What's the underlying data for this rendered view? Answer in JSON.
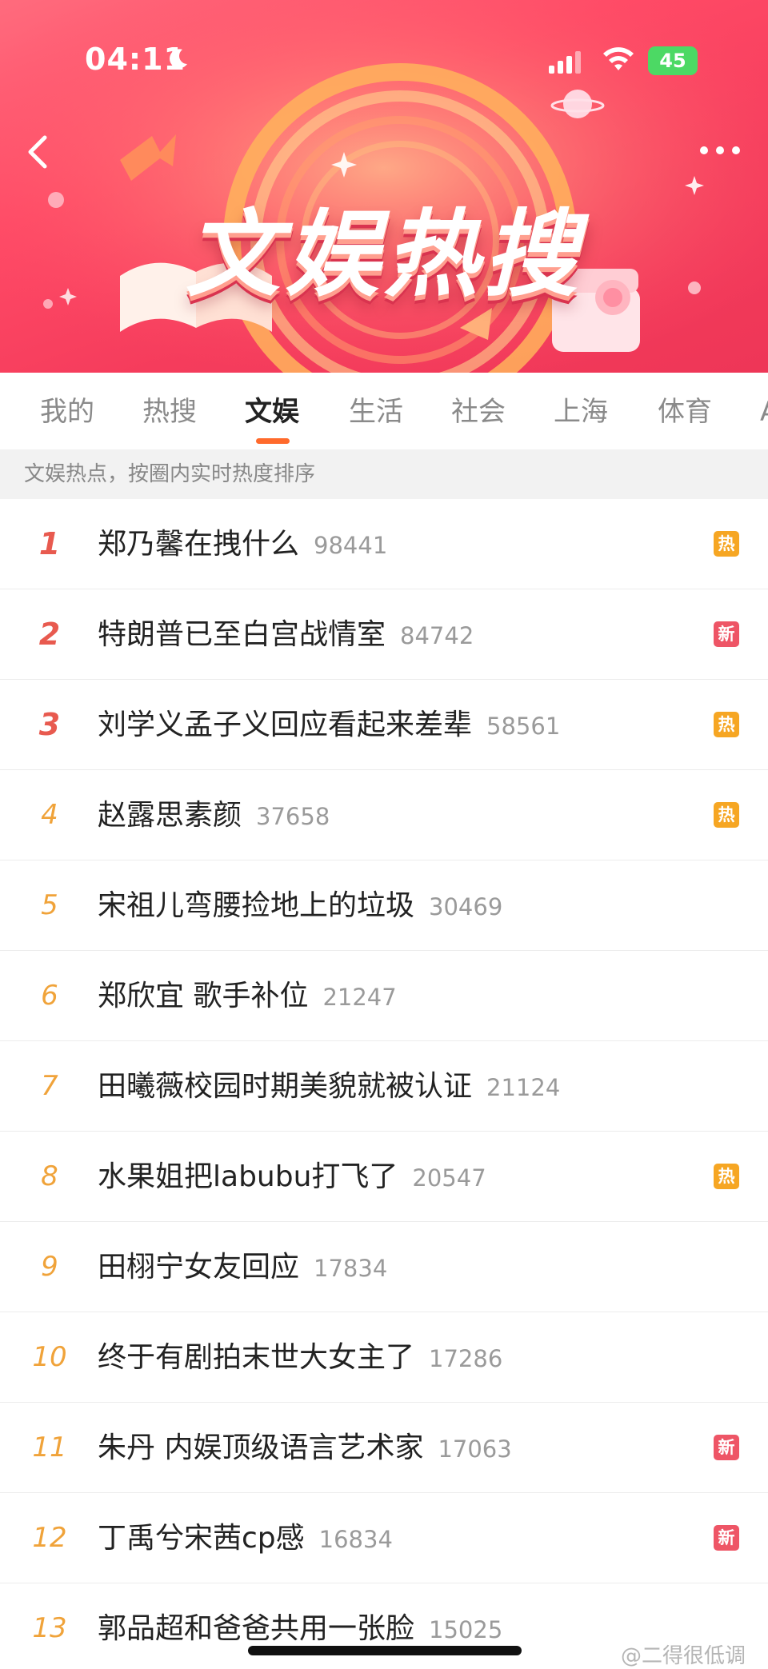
{
  "status_bar": {
    "time": "04:11",
    "battery": "45"
  },
  "header": {
    "title": "文娱热搜"
  },
  "tabs": [
    {
      "label": "我的"
    },
    {
      "label": "热搜"
    },
    {
      "label": "文娱",
      "active": true
    },
    {
      "label": "生活"
    },
    {
      "label": "社会"
    },
    {
      "label": "上海"
    },
    {
      "label": "体育"
    },
    {
      "label": "A"
    }
  ],
  "subtitle": "文娱热点，按圈内实时热度排序",
  "rows": [
    {
      "rank": "1",
      "title": "郑乃馨在拽什么",
      "count": "98441",
      "badge": "热"
    },
    {
      "rank": "2",
      "title": "特朗普已至白宫战情室",
      "count": "84742",
      "badge": "新"
    },
    {
      "rank": "3",
      "title": "刘学义孟子义回应看起来差辈",
      "count": "58561",
      "badge": "热"
    },
    {
      "rank": "4",
      "title": "赵露思素颜",
      "count": "37658",
      "badge": "热"
    },
    {
      "rank": "5",
      "title": "宋祖儿弯腰捡地上的垃圾",
      "count": "30469",
      "badge": ""
    },
    {
      "rank": "6",
      "title": "郑欣宜 歌手补位",
      "count": "21247",
      "badge": ""
    },
    {
      "rank": "7",
      "title": "田曦薇校园时期美貌就被认证",
      "count": "21124",
      "badge": ""
    },
    {
      "rank": "8",
      "title": "水果姐把labubu打飞了",
      "count": "20547",
      "badge": "热"
    },
    {
      "rank": "9",
      "title": "田栩宁女友回应",
      "count": "17834",
      "badge": ""
    },
    {
      "rank": "10",
      "title": "终于有剧拍末世大女主了",
      "count": "17286",
      "badge": ""
    },
    {
      "rank": "11",
      "title": "朱丹 内娱顶级语言艺术家",
      "count": "17063",
      "badge": "新"
    },
    {
      "rank": "12",
      "title": "丁禹兮宋茜cp感",
      "count": "16834",
      "badge": "新"
    },
    {
      "rank": "13",
      "title": "郭品超和爸爸共用一张脸",
      "count": "15025",
      "badge": ""
    }
  ],
  "watermark": "@二得很低调",
  "colors": {
    "accent": "#ff6a2c",
    "rank_top": "#e85a4f",
    "rank_other": "#f0a33a",
    "badge_hot": "#f6a623",
    "badge_new": "#ee5566"
  }
}
